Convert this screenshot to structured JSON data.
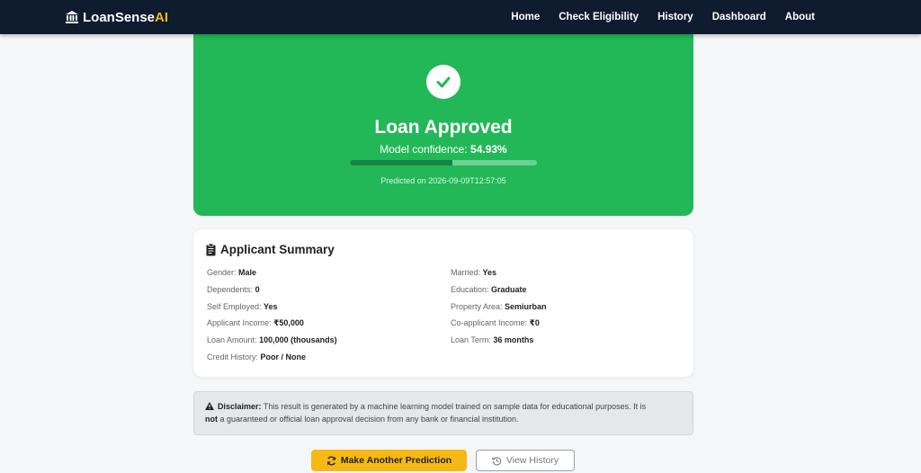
{
  "navbar": {
    "brand_name": "LoanSense",
    "brand_accent": "AI",
    "brand_icon": "bank-icon",
    "links": [
      "Home",
      "Check Eligibility",
      "History",
      "Dashboard",
      "About"
    ]
  },
  "result": {
    "icon": "check-icon",
    "title": "Loan Approved",
    "confidence_label": "Model confidence:",
    "confidence_value": "54.93%",
    "confidence_fraction": 0.5493,
    "predicted_on": "Predicted on 2026-09-09T12:57:05",
    "accent_color": "#22b857"
  },
  "summary": {
    "icon": "clipboard-icon",
    "title": "Applicant Summary",
    "left": [
      {
        "label": "Gender:",
        "value": "Male"
      },
      {
        "label": "Dependents:",
        "value": "0"
      },
      {
        "label": "Self Employed:",
        "value": "Yes"
      },
      {
        "label": "Applicant Income:",
        "value": "₹50,000"
      },
      {
        "label": "Loan Amount:",
        "value": "100,000 (thousands)"
      },
      {
        "label": "Credit History:",
        "value": "Poor / None"
      }
    ],
    "right": [
      {
        "label": "Married:",
        "value": "Yes"
      },
      {
        "label": "Education:",
        "value": "Graduate"
      },
      {
        "label": "Property Area:",
        "value": "Semiurban"
      },
      {
        "label": "Co-applicant Income:",
        "value": "₹0"
      },
      {
        "label": "Loan Term:",
        "value": "36 months"
      }
    ]
  },
  "disclaimer": {
    "icon": "warning-icon",
    "heading": "Disclaimer:",
    "text1": " This result is generated by a machine learning model trained on sample data for educational purposes. It is",
    "not_word": "not",
    "text2": " a guaranteed or official loan approval decision from any bank or financial institution."
  },
  "actions": {
    "primary_label": "Make Another Prediction",
    "primary_icon": "refresh-icon",
    "secondary_label": "View History",
    "secondary_icon": "history-icon",
    "primary_color": "#f5b915"
  }
}
